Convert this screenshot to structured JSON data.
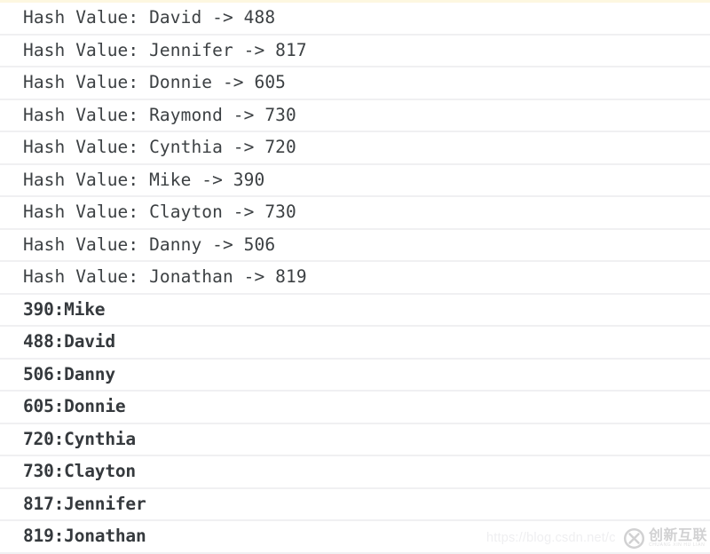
{
  "colors": {
    "background": "#ffffff",
    "text": "#3c4043",
    "separator": "#f0f0f2",
    "top_band": "#fdf7e0",
    "watermark": "#efeff1",
    "logo": "#b6b6b8"
  },
  "console": {
    "lines": [
      {
        "text": "Hash Value: David -> 488",
        "style": "hash"
      },
      {
        "text": "Hash Value: Jennifer -> 817",
        "style": "hash"
      },
      {
        "text": "Hash Value: Donnie -> 605",
        "style": "hash"
      },
      {
        "text": "Hash Value: Raymond -> 730",
        "style": "hash"
      },
      {
        "text": "Hash Value: Cynthia -> 720",
        "style": "hash"
      },
      {
        "text": "Hash Value: Mike -> 390",
        "style": "hash"
      },
      {
        "text": "Hash Value: Clayton -> 730",
        "style": "hash"
      },
      {
        "text": "Hash Value: Danny -> 506",
        "style": "hash"
      },
      {
        "text": "Hash Value: Jonathan -> 819",
        "style": "hash"
      },
      {
        "text": "390:Mike",
        "style": "sorted"
      },
      {
        "text": "488:David",
        "style": "sorted"
      },
      {
        "text": "506:Danny",
        "style": "sorted"
      },
      {
        "text": "605:Donnie",
        "style": "sorted"
      },
      {
        "text": "720:Cynthia",
        "style": "sorted"
      },
      {
        "text": "730:Clayton",
        "style": "sorted"
      },
      {
        "text": "817:Jennifer",
        "style": "sorted"
      },
      {
        "text": "819:Jonathan",
        "style": "sorted"
      }
    ]
  },
  "watermark": {
    "url": "https://blog.csdn.net/c",
    "logo_name_cn": "创新互联",
    "logo_pinyin": "CHUANG XIN HU LIAN",
    "logo_icon": "circled-x-icon"
  }
}
